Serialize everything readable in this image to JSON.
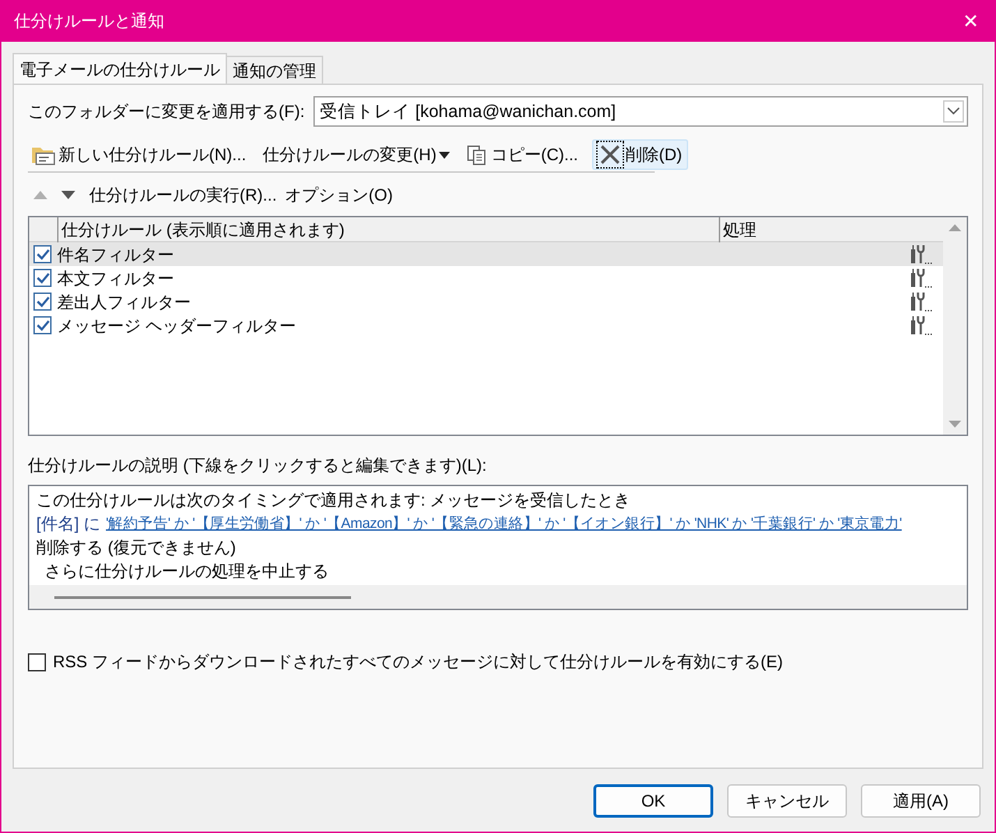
{
  "window": {
    "title": "仕分けルールと通知",
    "close": "✕"
  },
  "tabs": [
    {
      "label": "電子メールの仕分けルール",
      "selected": true
    },
    {
      "label": "通知の管理",
      "selected": false
    }
  ],
  "folder": {
    "label": "このフォルダーに変更を適用する(F):",
    "value": "受信トレイ [kohama@wanichan.com]"
  },
  "toolbar": [
    {
      "kind": "new",
      "label": "新しい仕分けルール(N)...",
      "focused": false
    },
    {
      "kind": "change",
      "label": "仕分けルールの変更(H)",
      "focused": false
    },
    {
      "kind": "copy",
      "label": "コピー(C)...",
      "focused": false
    },
    {
      "kind": "delete",
      "label": "削除(D)",
      "focused": true
    }
  ],
  "toolbar2": [
    {
      "kind": "up",
      "disabled": true
    },
    {
      "kind": "down",
      "disabled": false
    },
    {
      "kind": "text",
      "label": "仕分けルールの実行(R)..."
    },
    {
      "kind": "text",
      "label": "オプション(O)"
    }
  ],
  "rules": {
    "columns": [
      "仕分けルール (表示順に適用されます)",
      "処理"
    ],
    "rows": [
      {
        "name": "件名フィルター",
        "checked": true,
        "selected": true
      },
      {
        "name": "本文フィルター",
        "checked": true,
        "selected": false
      },
      {
        "name": "差出人フィルター",
        "checked": true,
        "selected": false
      },
      {
        "name": "メッセージ ヘッダーフィルター",
        "checked": true,
        "selected": false
      }
    ]
  },
  "description": {
    "label": "仕分けルールの説明 (下線をクリックすると編集できます)(L):",
    "lines": [
      {
        "kind": "plain",
        "text": "この仕分けルールは次のタイミングで適用されます: メッセージを受信したとき"
      },
      {
        "kind": "condition",
        "prefix": "[件名] に",
        "link": "'解約予告' か '【厚生労働省】' か '【Amazon】' か '【緊急の連絡】' か '【イオン銀行】' か 'NHK' か '千葉銀行' か '東京電力'"
      },
      {
        "kind": "plain",
        "text": "削除する (復元できません)"
      },
      {
        "kind": "indented",
        "text": "さらに仕分けルールの処理を中止する"
      }
    ]
  },
  "rss": {
    "label": "RSS フィードからダウンロードされたすべてのメッセージに対して仕分けルールを有効にする(E)",
    "checked": false
  },
  "buttons": [
    {
      "label": "OK",
      "default": true
    },
    {
      "label": "キャンセル",
      "default": false
    },
    {
      "label": "適用(A)",
      "default": false
    }
  ]
}
